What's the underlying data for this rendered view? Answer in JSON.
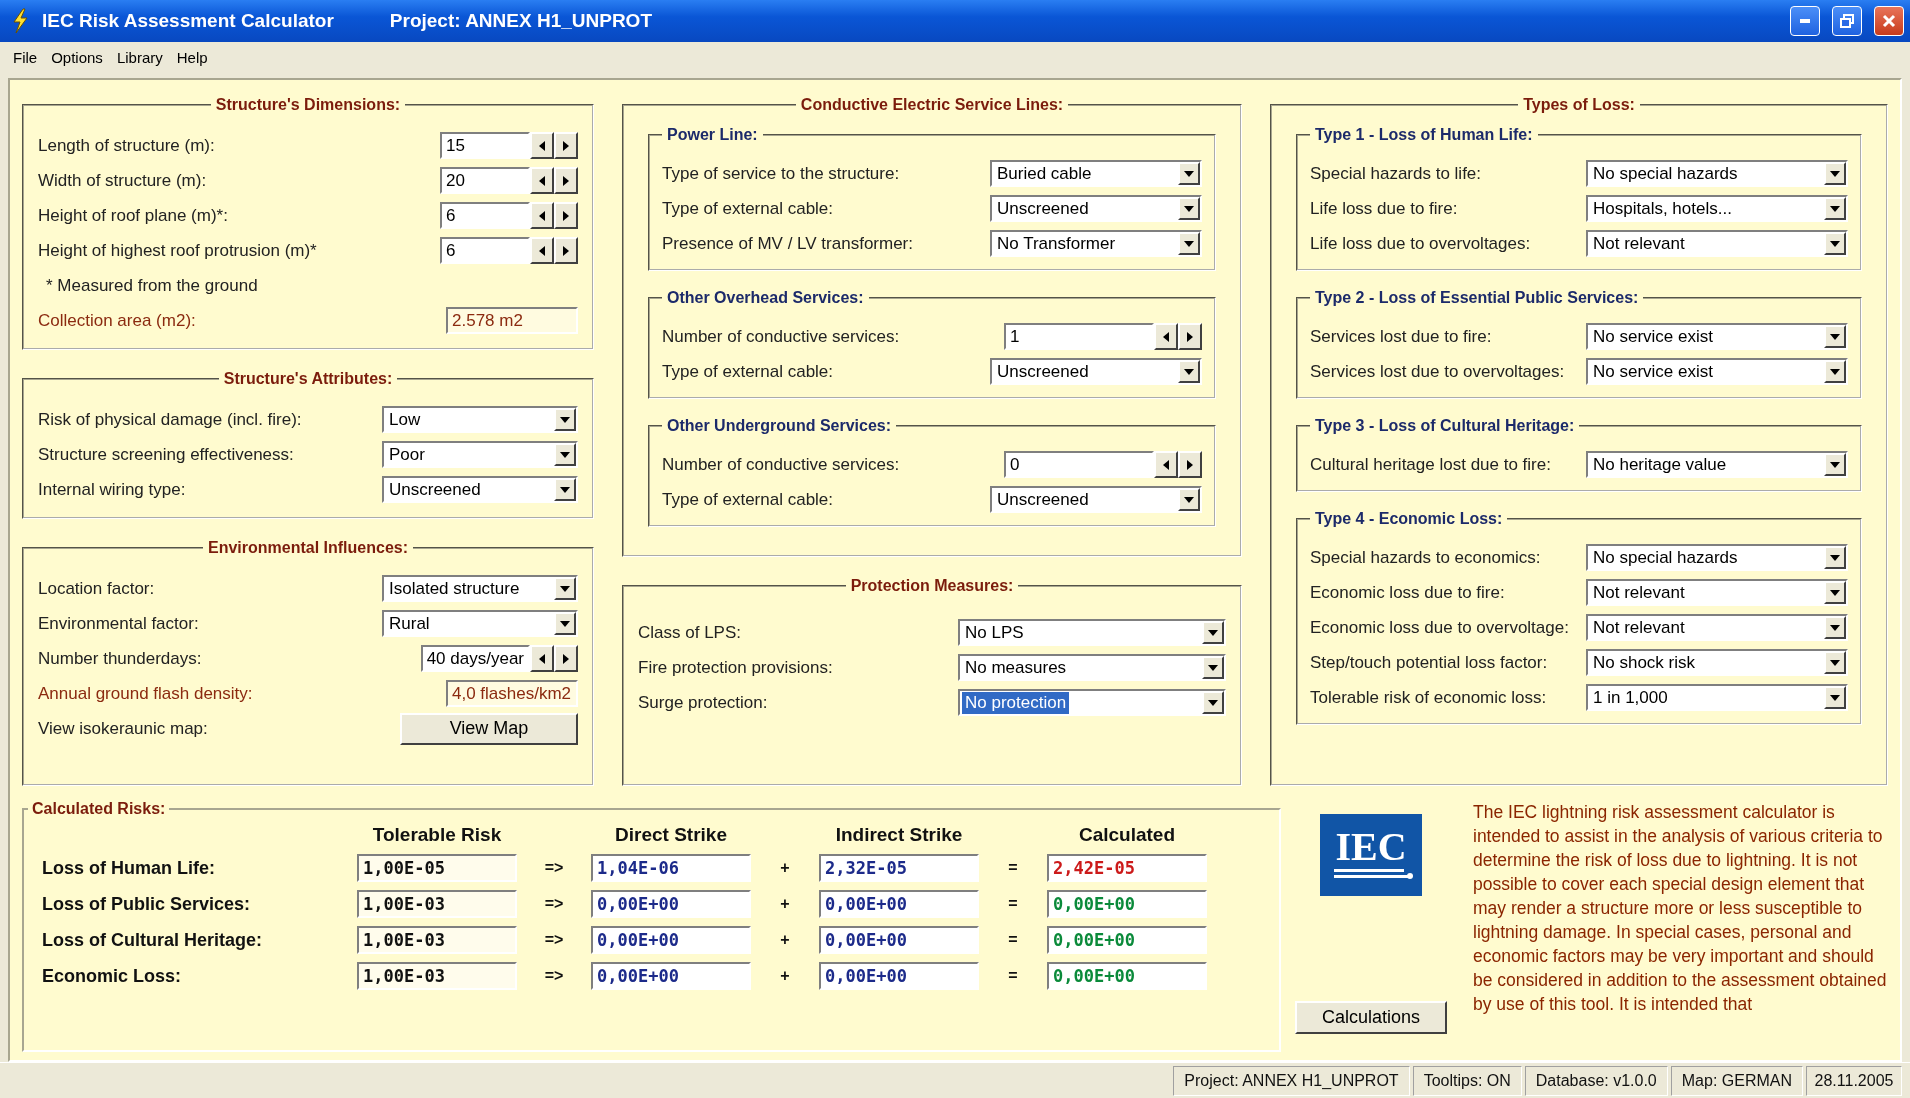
{
  "window": {
    "title": "IEC Risk Assessment Calculator",
    "project": "Project: ANNEX H1_UNPROT"
  },
  "menu": [
    "File",
    "Options",
    "Library",
    "Help"
  ],
  "columns": [
    {
      "groups": [
        {
          "title": "Structure's Dimensions:",
          "rows": [
            {
              "kind": "spin",
              "label": "Length of structure (m):",
              "value": "15"
            },
            {
              "kind": "spin",
              "label": "Width of structure (m):",
              "value": "20"
            },
            {
              "kind": "spin",
              "label": "Height of roof plane (m)*:",
              "value": "6"
            },
            {
              "kind": "spin",
              "label": "Height of highest roof protrusion (m)*",
              "value": "6"
            },
            {
              "kind": "note",
              "label": "* Measured from the ground"
            },
            {
              "kind": "output",
              "label": "Collection area (m2):",
              "value": "2.578 m2"
            }
          ]
        },
        {
          "title": "Structure's Attributes:",
          "rows": [
            {
              "kind": "select",
              "label": "Risk of physical damage (incl. fire):",
              "value": "Low",
              "highlighted": false
            },
            {
              "kind": "select",
              "label": "Structure screening effectiveness:",
              "value": "Poor",
              "highlighted": false
            },
            {
              "kind": "select",
              "label": "Internal wiring type:",
              "value": "Unscreened",
              "highlighted": false
            }
          ]
        },
        {
          "title": "Environmental Influences:",
          "rows": [
            {
              "kind": "select",
              "label": "Location factor:",
              "value": "Isolated structure",
              "highlighted": false
            },
            {
              "kind": "select",
              "label": "Environmental factor:",
              "value": "Rural",
              "highlighted": false
            },
            {
              "kind": "spin",
              "label": "Number thunderdays:",
              "value": "40 days/year"
            },
            {
              "kind": "output",
              "label": "Annual ground flash density:",
              "value": "4,0  flashes/km2"
            },
            {
              "kind": "button",
              "label": "View isokeraunic map:",
              "value": "View Map"
            }
          ]
        }
      ]
    },
    {
      "groups": [
        {
          "title": "Conductive Electric Service Lines:",
          "sections": [
            {
              "title": "Power Line:",
              "rows": [
                {
                  "kind": "select",
                  "label": "Type of service to the structure:",
                  "value": "Buried cable",
                  "highlighted": false
                },
                {
                  "kind": "select",
                  "label": "Type of external cable:",
                  "value": "Unscreened",
                  "highlighted": false
                },
                {
                  "kind": "select",
                  "label": "Presence of MV / LV transformer:",
                  "value": "No Transformer",
                  "highlighted": false
                }
              ]
            },
            {
              "title": "Other Overhead Services:",
              "rows": [
                {
                  "kind": "spin",
                  "label": "Number of conductive services:",
                  "value": "1"
                },
                {
                  "kind": "select",
                  "label": "Type of external cable:",
                  "value": "Unscreened",
                  "highlighted": false
                }
              ]
            },
            {
              "title": "Other Underground Services:",
              "rows": [
                {
                  "kind": "spin",
                  "label": "Number of conductive services:",
                  "value": "0"
                },
                {
                  "kind": "select",
                  "label": "Type of external cable:",
                  "value": "Unscreened",
                  "highlighted": false
                }
              ]
            }
          ]
        },
        {
          "title": "Protection Measures:",
          "rows": [
            {
              "kind": "select",
              "label": "Class of LPS:",
              "value": "No LPS",
              "highlighted": false
            },
            {
              "kind": "select",
              "label": "Fire protection provisions:",
              "value": "No measures",
              "highlighted": false
            },
            {
              "kind": "select",
              "label": "Surge protection:",
              "value": "No protection",
              "highlighted": true
            }
          ]
        }
      ]
    },
    {
      "groups": [
        {
          "title": "Types of Loss:",
          "sections": [
            {
              "title": "Type 1 - Loss of Human Life:",
              "rows": [
                {
                  "kind": "select",
                  "label": "Special hazards to life:",
                  "value": "No special hazards",
                  "highlighted": false
                },
                {
                  "kind": "select",
                  "label": "Life loss due to fire:",
                  "value": "Hospitals, hotels...",
                  "highlighted": false
                },
                {
                  "kind": "select",
                  "label": "Life loss due to overvoltages:",
                  "value": "Not relevant",
                  "highlighted": false
                }
              ]
            },
            {
              "title": "Type 2 - Loss of Essential Public Services:",
              "rows": [
                {
                  "kind": "select",
                  "label": "Services lost due to fire:",
                  "value": "No service exist",
                  "highlighted": false
                },
                {
                  "kind": "select",
                  "label": "Services lost due to overvoltages:",
                  "value": "No service exist",
                  "highlighted": false
                }
              ]
            },
            {
              "title": "Type 3 - Loss of Cultural Heritage:",
              "rows": [
                {
                  "kind": "select",
                  "label": "Cultural heritage lost due to fire:",
                  "value": "No heritage value",
                  "highlighted": false
                }
              ]
            },
            {
              "title": "Type 4 - Economic Loss:",
              "rows": [
                {
                  "kind": "select",
                  "label": "Special hazards to economics:",
                  "value": "No special hazards",
                  "highlighted": false
                },
                {
                  "kind": "select",
                  "label": "Economic loss due to fire:",
                  "value": "Not relevant",
                  "highlighted": false
                },
                {
                  "kind": "select",
                  "label": "Economic loss due to overvoltage:",
                  "value": "Not relevant",
                  "highlighted": false
                },
                {
                  "kind": "select",
                  "label": "Step/touch potential loss factor:",
                  "value": "No shock risk",
                  "highlighted": false
                },
                {
                  "kind": "select",
                  "label": "Tolerable risk of economic loss:",
                  "value": "1 in 1,000",
                  "highlighted": false
                }
              ]
            }
          ]
        }
      ]
    }
  ],
  "risks": {
    "title": "Calculated Risks:",
    "headers": [
      "Tolerable Risk",
      "Direct Strike",
      "Indirect Strike",
      "Calculated"
    ],
    "rows": [
      {
        "label": "Loss of Human Life:",
        "tolerable": "1,00E-05",
        "op1": "=>",
        "direct": "1,04E-06",
        "op2": "+",
        "indirect": "2,32E-05",
        "op3": "=",
        "calculated": "2,42E-05",
        "color": "#cc1a1a"
      },
      {
        "label": "Loss of Public Services:",
        "tolerable": "1,00E-03",
        "op1": "=>",
        "direct": "0,00E+00",
        "op2": "+",
        "indirect": "0,00E+00",
        "op3": "=",
        "calculated": "0,00E+00",
        "color": "#0a8a3a"
      },
      {
        "label": "Loss of Cultural Heritage:",
        "tolerable": "1,00E-03",
        "op1": "=>",
        "direct": "0,00E+00",
        "op2": "+",
        "indirect": "0,00E+00",
        "op3": "=",
        "calculated": "0,00E+00",
        "color": "#0a8a3a"
      },
      {
        "label": "Economic Loss:",
        "tolerable": "1,00E-03",
        "op1": "=>",
        "direct": "0,00E+00",
        "op2": "+",
        "indirect": "0,00E+00",
        "op3": "=",
        "calculated": "0,00E+00",
        "color": "#0a8a3a"
      }
    ]
  },
  "logo_text": "IEC",
  "calculations_button": "Calculations",
  "description": "The IEC lightning risk assessment calculator is intended to assist in the analysis of various criteria to determine the risk of loss due to lightning. It is not possible to cover each special design element that may render a structure more or less susceptible to lightning damage. In special cases, personal and economic factors may be very important and should be considered in addition to the assessment obtained by use of this tool. It is intended that",
  "status_bar": [
    "Project: ANNEX H1_UNPROT",
    "Tooltips: ON",
    "Database: v1.0.0",
    "Map: GERMAN",
    "28.11.2005"
  ]
}
